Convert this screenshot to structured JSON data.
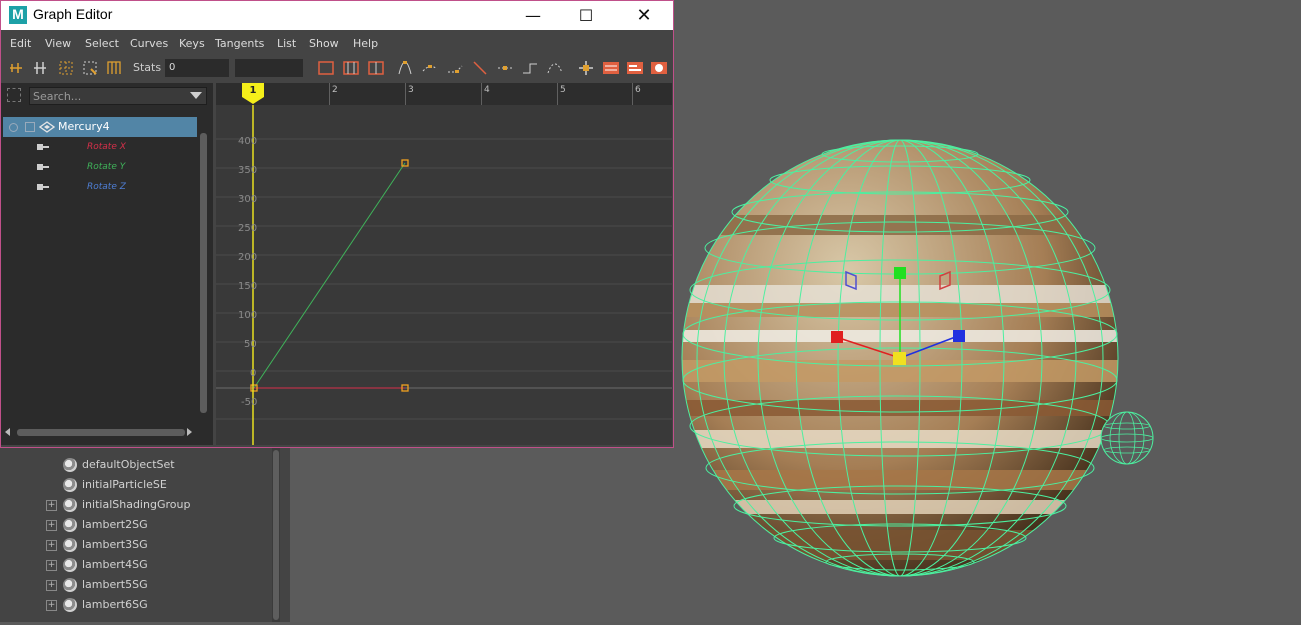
{
  "window": {
    "title": "Graph Editor",
    "logo_letter": "M",
    "min_glyph": "—",
    "max_glyph": "☐",
    "close_glyph": "✕"
  },
  "menu": [
    "Edit",
    "View",
    "Select",
    "Curves",
    "Keys",
    "Tangents",
    "List",
    "Show",
    "Help"
  ],
  "toolbar": {
    "stats_label": "Stats",
    "stats_value": "0"
  },
  "outliner_panel": {
    "search_placeholder": "Search...",
    "object": "Mercury4",
    "attributes": [
      {
        "label": "Rotate X",
        "color": "#d6304a"
      },
      {
        "label": "Rotate Y",
        "color": "#3fb35a"
      },
      {
        "label": "Rotate Z",
        "color": "#4f7fd6"
      }
    ]
  },
  "graph": {
    "current_frame": "1",
    "frame_labels": [
      "2",
      "3",
      "4",
      "5",
      "6"
    ],
    "value_labels": [
      "400",
      "350",
      "300",
      "250",
      "200",
      "150",
      "100",
      "50",
      "0",
      "-50"
    ],
    "curve_colors": {
      "rotate_x": "#d6304a",
      "rotate_y": "#3fb35a",
      "key": "#f0a020",
      "time": "#e8e020"
    }
  },
  "background_outliner": {
    "rows": [
      {
        "label": "defaultObjectSet",
        "expandable": false
      },
      {
        "label": "initialParticleSE",
        "expandable": false
      },
      {
        "label": "initialShadingGroup",
        "expandable": true
      },
      {
        "label": "lambert2SG",
        "expandable": true
      },
      {
        "label": "lambert3SG",
        "expandable": true
      },
      {
        "label": "lambert4SG",
        "expandable": true
      },
      {
        "label": "lambert5SG",
        "expandable": true
      },
      {
        "label": "lambert6SG",
        "expandable": true
      }
    ]
  },
  "viewport": {
    "wireframe_color": "#4cf0a0",
    "manipulator": {
      "x_color": "#e02020",
      "y_color": "#20e020",
      "z_color": "#2030e0",
      "center_color": "#f0e020"
    }
  }
}
